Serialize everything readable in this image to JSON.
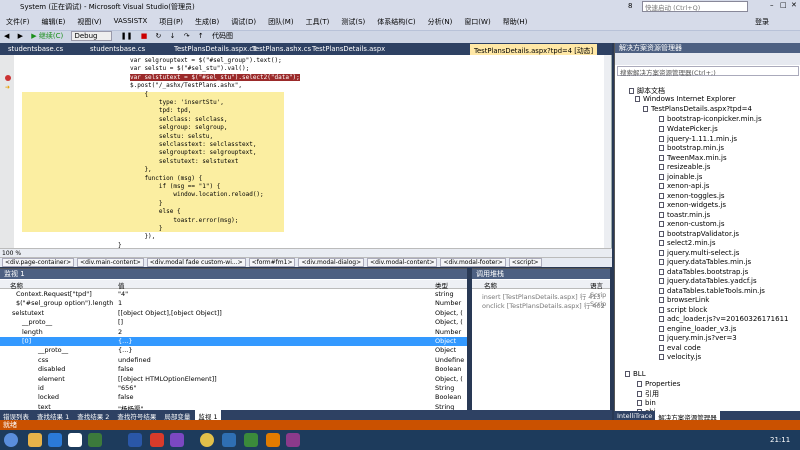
{
  "window": {
    "title": "System (正在调试) - Microsoft Visual Studio(管理员)",
    "notif": "8",
    "quick_launch": "快速启动 (Ctrl+Q)",
    "login": "登录"
  },
  "menu": [
    "文件(F)",
    "编辑(E)",
    "视图(V)",
    "VASSISTX",
    "项目(P)",
    "生成(B)",
    "调试(D)",
    "团队(M)",
    "工具(T)",
    "测试(S)",
    "体系结构(C)",
    "分析(N)",
    "窗口(W)",
    "帮助(H)"
  ],
  "toolbar": {
    "continue": "继续(C)",
    "config": "Debug",
    "codemap": "代码图"
  },
  "tabs": [
    "studentsbase.cs",
    "studentsbase.cs",
    "TestPlansDetails.aspx.cs",
    "TestPlans.ashx.cs",
    "TestPlansDetails.aspx",
    "TestPlansDetails.aspx?tpd=4 [动态]"
  ],
  "code": [
    "var selgrouptext = $(\"#sel_group\").text();",
    "var selstu = $(\"#sel_stu\").val();",
    "var selstutext = $(\"#sel_stu\").select2(\"data\");",
    "$.post(\"/_ashx/TestPlans.ashx\",",
    "    {",
    "        type: 'insertStu',",
    "        tpd: tpd,",
    "        selclass: selclass,",
    "        selgroup: selgroup,",
    "        selstu: selstu,",
    "        selclasstext: selclasstext,",
    "        selgrouptext: selgrouptext,",
    "        selstutext: selstutext",
    "    },",
    "    function (msg) {",
    "        if (msg == \"1\") {",
    "            window.location.reload();",
    "        }",
    "        else {",
    "            toastr.error(msg);",
    "        }",
    "    }),",
    "}"
  ],
  "zoom": "100 %",
  "crumbs": [
    "<div.page-container>",
    "<div.main-content>",
    "<div.modal fade custom-wi...>",
    "<form#fm1>",
    "<div.modal-dialog>",
    "<div.modal-content>",
    "<div.modal-footer>",
    "<script>"
  ],
  "watch": {
    "title": "监视 1",
    "cols": [
      "名称",
      "值",
      "类型"
    ],
    "rows": [
      [
        "Context.Request[\"tpd\"]",
        "\"4\"",
        "string"
      ],
      [
        "$(\"#sel_group option\").length",
        "1",
        "Number"
      ],
      [
        "selstutext",
        "[[object Object],[object Object]]",
        "Object, ("
      ],
      [
        "__proto__",
        "[]",
        "Object, ("
      ],
      [
        "length",
        "2",
        "Number"
      ],
      [
        "[0]",
        "{...}",
        "Object"
      ],
      [
        "__proto__",
        "{...}",
        "Object"
      ],
      [
        "css",
        "undefined",
        "Undefine"
      ],
      [
        "disabled",
        "false",
        "Boolean"
      ],
      [
        "element",
        "[[object HTMLOptionElement]]",
        "Object, ("
      ],
      [
        "id",
        "\"656\"",
        "String"
      ],
      [
        "locked",
        "false",
        "Boolean"
      ],
      [
        "text",
        "\"杨杨渠\"",
        "String"
      ]
    ]
  },
  "callstack": {
    "title": "调用堆栈",
    "cols": [
      "名称",
      "语言"
    ],
    "rows": [
      [
        "insert [TestPlansDetails.aspx] 行 413",
        "Scrip"
      ],
      [
        "onclick [TestPlansDetails.aspx] 行 402",
        "Scrip"
      ]
    ]
  },
  "bottomtabs": [
    "错误列表",
    "查找结果 1",
    "查找结果 2",
    "查找符号结果",
    "局部变量",
    "监视 1"
  ],
  "solution": {
    "title": "解决方案资源管理器",
    "search": "搜索解决方案资源管理器(Ctrl+;)",
    "items": [
      "脚本文档",
      "Windows Internet Explorer",
      "TestPlansDetails.aspx?tpd=4",
      "bootstrap-iconpicker.min.js",
      "WdatePicker.js",
      "jquery-1.11.1.min.js",
      "bootstrap.min.js",
      "TweenMax.min.js",
      "resizeable.js",
      "joinable.js",
      "xenon-api.js",
      "xenon-toggles.js",
      "xenon-widgets.js",
      "toastr.min.js",
      "xenon-custom.js",
      "bootstrapValidator.js",
      "select2.min.js",
      "jquery.multi-select.js",
      "jquery.dataTables.min.js",
      "dataTables.bootstrap.js",
      "jquery.dataTables.yadcf.js",
      "dataTables.tableTools.min.js",
      "browserLink",
      "script block",
      "adc_loader.js?v=20160326171611",
      "engine_loader_v3.js",
      "jquery.min.js?ver=3",
      "eval code",
      "velocity.js",
      "BLL",
      "Properties",
      "引用",
      "bin",
      "obj"
    ],
    "tabs": [
      "IntelliTrace",
      "解决方案资源管理器"
    ]
  },
  "status": "就绪",
  "clock": "21:11"
}
